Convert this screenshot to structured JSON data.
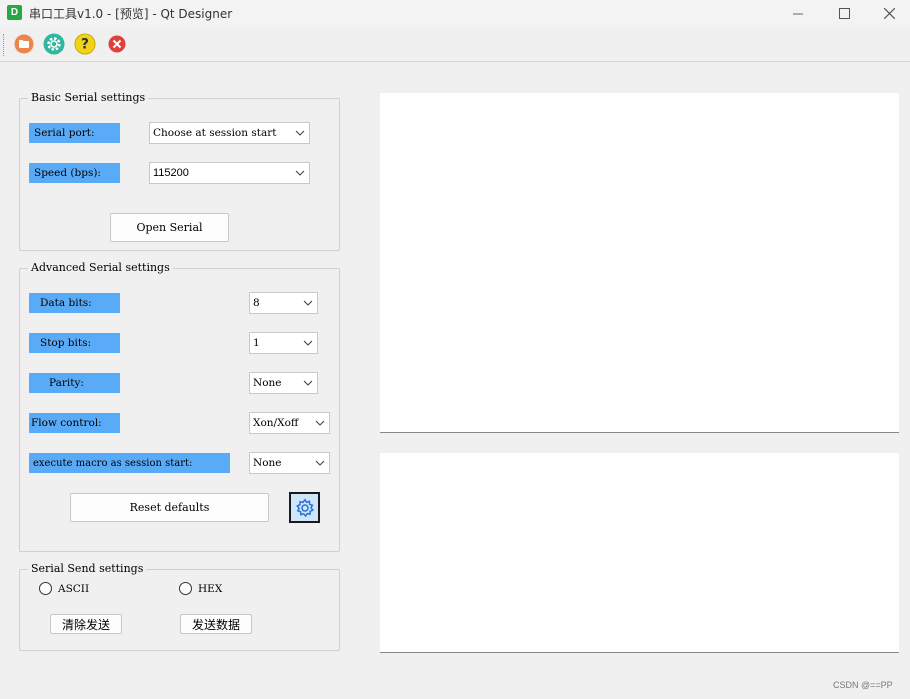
{
  "window": {
    "app_icon_letter": "D",
    "title": "串口工具v1.0 - [预览] - Qt Designer"
  },
  "toolbar": {
    "items": [
      {
        "icon": "open-folder-icon",
        "color": "#e9874d"
      },
      {
        "icon": "gear-icon",
        "color": "#2fb5a0"
      },
      {
        "icon": "help-icon",
        "color": "#f0d21a"
      },
      {
        "icon": "close-icon",
        "color": "#e0403a"
      }
    ]
  },
  "basic": {
    "title": "Basic Serial settings",
    "port_label": "Serial port:",
    "port_value": "Choose at session start",
    "speed_label": "Speed (bps):",
    "speed_value": "115200",
    "open_button": "Open Serial"
  },
  "advanced": {
    "title": "Advanced Serial settings",
    "data_bits_label": "Data bits:",
    "data_bits_value": "8",
    "stop_bits_label": "Stop bits:",
    "stop_bits_value": "1",
    "parity_label": "Parity:",
    "parity_value": "None",
    "flow_label": "Flow control:",
    "flow_value": "Xon/Xoff",
    "macro_label": "execute macro as session start:",
    "macro_value": "None",
    "reset_button": "Reset defaults",
    "settings_icon": "gear-icon"
  },
  "send": {
    "title": "Serial Send settings",
    "ascii_label": "ASCII",
    "hex_label": "HEX",
    "clear_button": "清除发送",
    "send_button": "发送数据"
  },
  "watermark": "CSDN @==PP",
  "colors": {
    "label_bg": "#5aabf7",
    "settings_button_bg": "#cde6fb"
  }
}
